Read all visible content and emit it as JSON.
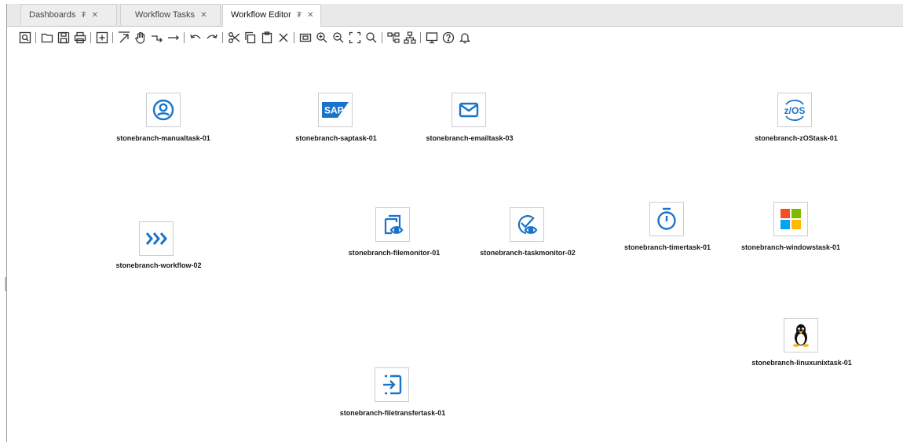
{
  "tabs": [
    {
      "label": "Dashboards",
      "pinned": true,
      "closable": true,
      "active": false
    },
    {
      "label": "Workflow Tasks",
      "pinned": false,
      "closable": true,
      "active": false
    },
    {
      "label": "Workflow Editor",
      "pinned": true,
      "closable": true,
      "active": true
    }
  ],
  "tab_glyphs": {
    "pin": "₮",
    "close": "✕"
  },
  "toolbar_icons": [
    "preview-icon",
    "open-folder-icon",
    "save-icon",
    "print-icon",
    "add-icon",
    "select-arrow-icon",
    "pan-hand-icon",
    "connector-icon",
    "straight-connector-icon",
    "undo-icon",
    "redo-icon",
    "cut-icon",
    "copy-icon",
    "paste-icon",
    "delete-icon",
    "zoom-fit-icon",
    "zoom-in-icon",
    "zoom-out-icon",
    "fit-page-icon",
    "search-icon",
    "layout-horizontal-icon",
    "layout-vertical-icon",
    "monitor-icon",
    "help-icon",
    "notification-bell-icon"
  ],
  "nodes": {
    "manualtask": {
      "label": "stonebranch-manualtask-01",
      "icon": "user-circle-icon"
    },
    "saptask": {
      "label": "stonebranch-saptask-01",
      "icon": "sap-logo-icon",
      "logo_text": "SAP"
    },
    "emailtask": {
      "label": "stonebranch-emailtask-03",
      "icon": "envelope-icon"
    },
    "zostask": {
      "label": "stonebranch-zOStask-01",
      "icon": "zos-logo-icon",
      "logo_text": "z/OS"
    },
    "workflow": {
      "label": "stonebranch-workflow-02",
      "icon": "workflow-chevrons-icon"
    },
    "filemonitor": {
      "label": "stonebranch-filemonitor-01",
      "icon": "file-monitor-icon"
    },
    "taskmonitor": {
      "label": "stonebranch-taskmonitor-02",
      "icon": "task-monitor-icon"
    },
    "timertask": {
      "label": "stonebranch-timertask-01",
      "icon": "stopwatch-icon"
    },
    "windowstask": {
      "label": "stonebranch-windowstask-01",
      "icon": "windows-logo-icon"
    },
    "linuxunixtask": {
      "label": "stonebranch-linuxunixtask-01",
      "icon": "linux-penguin-icon"
    },
    "filetransfertask": {
      "label": "stonebranch-filetransfertask-01",
      "icon": "file-transfer-icon"
    }
  },
  "colors": {
    "accent": "#1a73c9",
    "windows_red": "#f25022",
    "windows_green": "#7fba00",
    "windows_blue": "#00a4ef",
    "windows_yellow": "#ffb900"
  }
}
